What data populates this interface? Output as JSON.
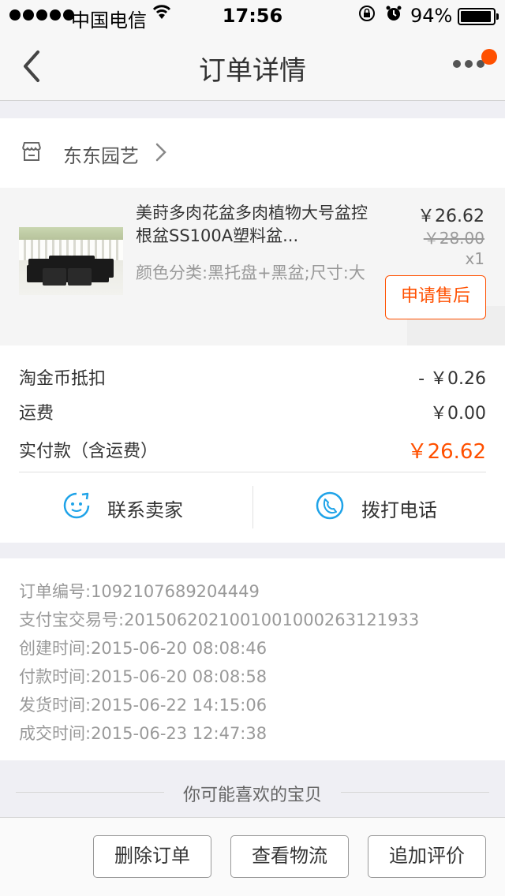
{
  "status_bar": {
    "carrier": "中国电信",
    "time": "17:56",
    "battery": "94%",
    "battery_level": 0.94,
    "icons": [
      "signal-dots-icon",
      "wifi-icon",
      "orientation-lock-icon",
      "alarm-icon",
      "battery-icon"
    ]
  },
  "nav": {
    "title": "订单详情",
    "back_icon": "chevron-left-icon",
    "more_icon": "more-dots-icon",
    "badge_color": "#ff5000"
  },
  "shop": {
    "name": "东东园艺",
    "icon": "shop-icon"
  },
  "product": {
    "name": "美莳多肉花盆多肉植物大号盆控根盆SS100A塑料盆...",
    "spec": "颜色分类:黑托盘+黑盆;尺寸:大",
    "price": "￥26.62",
    "original_price": "￥28.00",
    "quantity": "x1",
    "after_sale_label": "申请售后"
  },
  "summary": {
    "coin_label": "淘金币抵扣",
    "coin_value": "- ￥0.26",
    "shipping_label": "运费",
    "shipping_value": "￥0.00",
    "total_label": "实付款（含运费）",
    "total_value": "￥26.62",
    "accent_color": "#ff5000"
  },
  "actions": {
    "contact_seller": "联系卖家",
    "call_phone": "拨打电话",
    "icon_color": "#1fa3e8"
  },
  "order_info": {
    "lines": [
      "订单编号:1092107689204449",
      "支付宝交易号:2015062021001001000263121933",
      "创建时间:2015-06-20 08:08:46",
      "付款时间:2015-06-20 08:08:58",
      "发货时间:2015-06-22 14:15:06",
      "成交时间:2015-06-23 12:47:38"
    ]
  },
  "recommend": {
    "label": "你可能喜欢的宝贝"
  },
  "bottom_bar": {
    "delete_order": "删除订单",
    "view_logistics": "查看物流",
    "add_review": "追加评价"
  }
}
